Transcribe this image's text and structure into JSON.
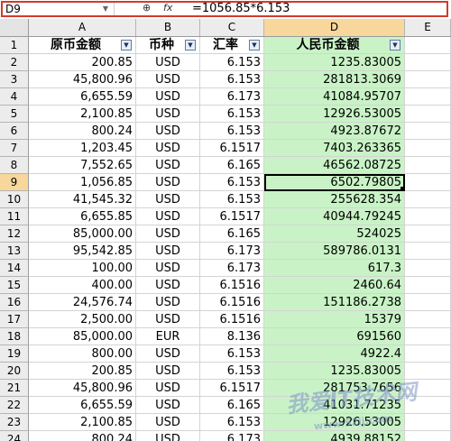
{
  "formula_bar": {
    "name_box": "D9",
    "fx_label": "fx",
    "formula": "=1056.85*6.153"
  },
  "columns": [
    "A",
    "B",
    "C",
    "D",
    "E"
  ],
  "active_column": "D",
  "header_row": {
    "row_number": "1",
    "cells": [
      "原币金额",
      "币种",
      "汇率",
      "人民币金额"
    ]
  },
  "rows": [
    {
      "n": "2",
      "a": "200.85",
      "b": "USD",
      "c": "6.153",
      "d": "1235.83005"
    },
    {
      "n": "3",
      "a": "45,800.96",
      "b": "USD",
      "c": "6.153",
      "d": "281813.3069"
    },
    {
      "n": "4",
      "a": "6,655.59",
      "b": "USD",
      "c": "6.173",
      "d": "41084.95707"
    },
    {
      "n": "5",
      "a": "2,100.85",
      "b": "USD",
      "c": "6.153",
      "d": "12926.53005"
    },
    {
      "n": "6",
      "a": "800.24",
      "b": "USD",
      "c": "6.153",
      "d": "4923.87672"
    },
    {
      "n": "7",
      "a": "1,203.45",
      "b": "USD",
      "c": "6.1517",
      "d": "7403.263365"
    },
    {
      "n": "8",
      "a": "7,552.65",
      "b": "USD",
      "c": "6.165",
      "d": "46562.08725"
    },
    {
      "n": "9",
      "a": "1,056.85",
      "b": "USD",
      "c": "6.153",
      "d": "6502.79805"
    },
    {
      "n": "10",
      "a": "41,545.32",
      "b": "USD",
      "c": "6.153",
      "d": "255628.354"
    },
    {
      "n": "11",
      "a": "6,655.85",
      "b": "USD",
      "c": "6.1517",
      "d": "40944.79245"
    },
    {
      "n": "12",
      "a": "85,000.00",
      "b": "USD",
      "c": "6.165",
      "d": "524025"
    },
    {
      "n": "13",
      "a": "95,542.85",
      "b": "USD",
      "c": "6.173",
      "d": "589786.0131"
    },
    {
      "n": "14",
      "a": "100.00",
      "b": "USD",
      "c": "6.173",
      "d": "617.3"
    },
    {
      "n": "15",
      "a": "400.00",
      "b": "USD",
      "c": "6.1516",
      "d": "2460.64"
    },
    {
      "n": "16",
      "a": "24,576.74",
      "b": "USD",
      "c": "6.1516",
      "d": "151186.2738"
    },
    {
      "n": "17",
      "a": "2,500.00",
      "b": "USD",
      "c": "6.1516",
      "d": "15379"
    },
    {
      "n": "18",
      "a": "85,000.00",
      "b": "EUR",
      "c": "8.136",
      "d": "691560"
    },
    {
      "n": "19",
      "a": "800.00",
      "b": "USD",
      "c": "6.153",
      "d": "4922.4"
    },
    {
      "n": "20",
      "a": "200.85",
      "b": "USD",
      "c": "6.153",
      "d": "1235.83005"
    },
    {
      "n": "21",
      "a": "45,800.96",
      "b": "USD",
      "c": "6.1517",
      "d": "281753.7656"
    },
    {
      "n": "22",
      "a": "6,655.59",
      "b": "USD",
      "c": "6.165",
      "d": "41031.71235"
    },
    {
      "n": "23",
      "a": "2,100.85",
      "b": "USD",
      "c": "6.153",
      "d": "12926.53005"
    },
    {
      "n": "24",
      "a": "800.24",
      "b": "USD",
      "c": "6.173",
      "d": "4939.88152"
    }
  ],
  "selected_cell": "D9",
  "watermark": {
    "text": "我爱IT技术网",
    "sub": "www.52ij.com"
  },
  "colors": {
    "highlight_column": "#c9f3c6",
    "active_header": "#f7d79b",
    "formula_outline": "#d33a2c"
  }
}
